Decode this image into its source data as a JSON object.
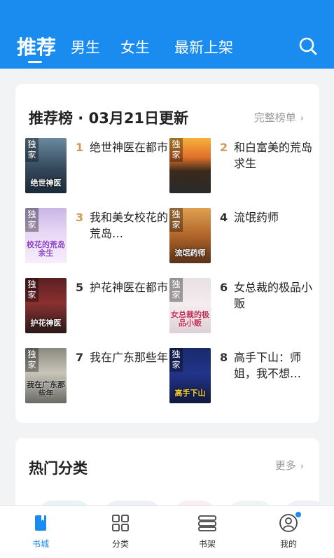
{
  "header": {
    "tabs": [
      {
        "label": "推荐",
        "active": true
      },
      {
        "label": "男生",
        "active": false
      },
      {
        "label": "女生",
        "active": false
      },
      {
        "label": "最新上架",
        "active": false
      }
    ],
    "search_icon": "search-icon",
    "accent_color": "#1a8cf0"
  },
  "ranking": {
    "title": "推荐榜 · 03月21日更新",
    "more_label": "完整榜单",
    "books": [
      {
        "rank": "1",
        "title": "绝世神医在都市",
        "badge": "独家",
        "cover_text": "绝世神医"
      },
      {
        "rank": "2",
        "title": "和白富美的荒岛求生",
        "badge": "独家",
        "cover_text": ""
      },
      {
        "rank": "3",
        "title": "我和美女校花的荒岛…",
        "badge": "独家",
        "cover_text": "校花的荒岛余生"
      },
      {
        "rank": "4",
        "title": "流氓药师",
        "badge": "独家",
        "cover_text": "流氓药师"
      },
      {
        "rank": "5",
        "title": "护花神医在都市",
        "badge": "独家",
        "cover_text": "护花神医"
      },
      {
        "rank": "6",
        "title": "女总裁的极品小贩",
        "badge": "独家",
        "cover_text": "女总裁的极品小贩"
      },
      {
        "rank": "7",
        "title": "我在广东那些年",
        "badge": "独家",
        "cover_text": "我在广东那些年"
      },
      {
        "rank": "8",
        "title": "高手下山：师姐，我不想…",
        "badge": "独家",
        "cover_text": "高手下山"
      }
    ]
  },
  "categories": {
    "title": "热门分类",
    "more_label": "更多"
  },
  "bottom_nav": [
    {
      "label": "书城",
      "icon": "book-city-icon",
      "active": true
    },
    {
      "label": "分类",
      "icon": "category-grid-icon",
      "active": false
    },
    {
      "label": "书架",
      "icon": "bookshelf-icon",
      "active": false
    },
    {
      "label": "我的",
      "icon": "profile-icon",
      "active": false
    }
  ]
}
